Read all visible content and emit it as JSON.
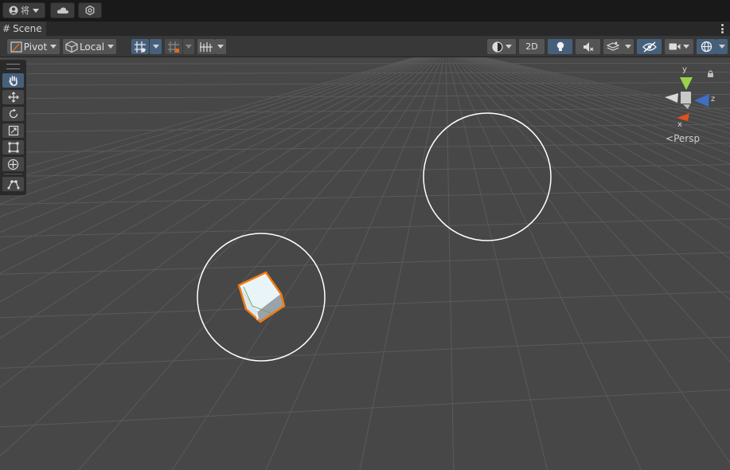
{
  "topbar": {
    "account_glyph": "将",
    "account_icon": "account-icon",
    "cloud_icon": "cloud-icon",
    "settings_icon": "services-gear-icon"
  },
  "tab": {
    "label": "Scene",
    "menu_icon": "kebab-menu-icon"
  },
  "toolbar": {
    "pivot_label": "Pivot",
    "local_label": "Local",
    "view_2d_label": "2D",
    "icons": {
      "pivot": "pivot-icon",
      "local": "cube-local-icon",
      "grid_snap": "grid-snap-icon",
      "grid": "grid-icon",
      "increment": "increment-snap-icon",
      "draw_mode": "shading-mode-icon",
      "lighting": "lightbulb-icon",
      "audio": "audio-mute-icon",
      "effects": "effects-icon",
      "visibility": "hidden-visibility-icon",
      "camera": "camera-icon",
      "gizmos": "gizmos-icon"
    }
  },
  "tools": [
    {
      "name": "hand-tool",
      "active": true
    },
    {
      "name": "move-tool",
      "active": false
    },
    {
      "name": "rotate-tool",
      "active": false
    },
    {
      "name": "scale-tool",
      "active": false
    },
    {
      "name": "rect-tool",
      "active": false
    },
    {
      "name": "transform-tool",
      "active": false
    },
    {
      "name": "custom-tool",
      "active": false
    }
  ],
  "gizmo": {
    "y_label": "y",
    "z_label": "z",
    "x_label": "x",
    "view_label": "Persp",
    "lock_icon": "lock-icon",
    "colors": {
      "y": "#9bd14b",
      "z": "#3f6ec4",
      "x": "#e0511e",
      "neutral": "#d8d8d8"
    }
  },
  "colors": {
    "viewport_bg": "#474747",
    "grid_line": "#595959",
    "selection": "#f07a12",
    "cube_face": "#e8f4f8",
    "circle": "#ffffff"
  }
}
